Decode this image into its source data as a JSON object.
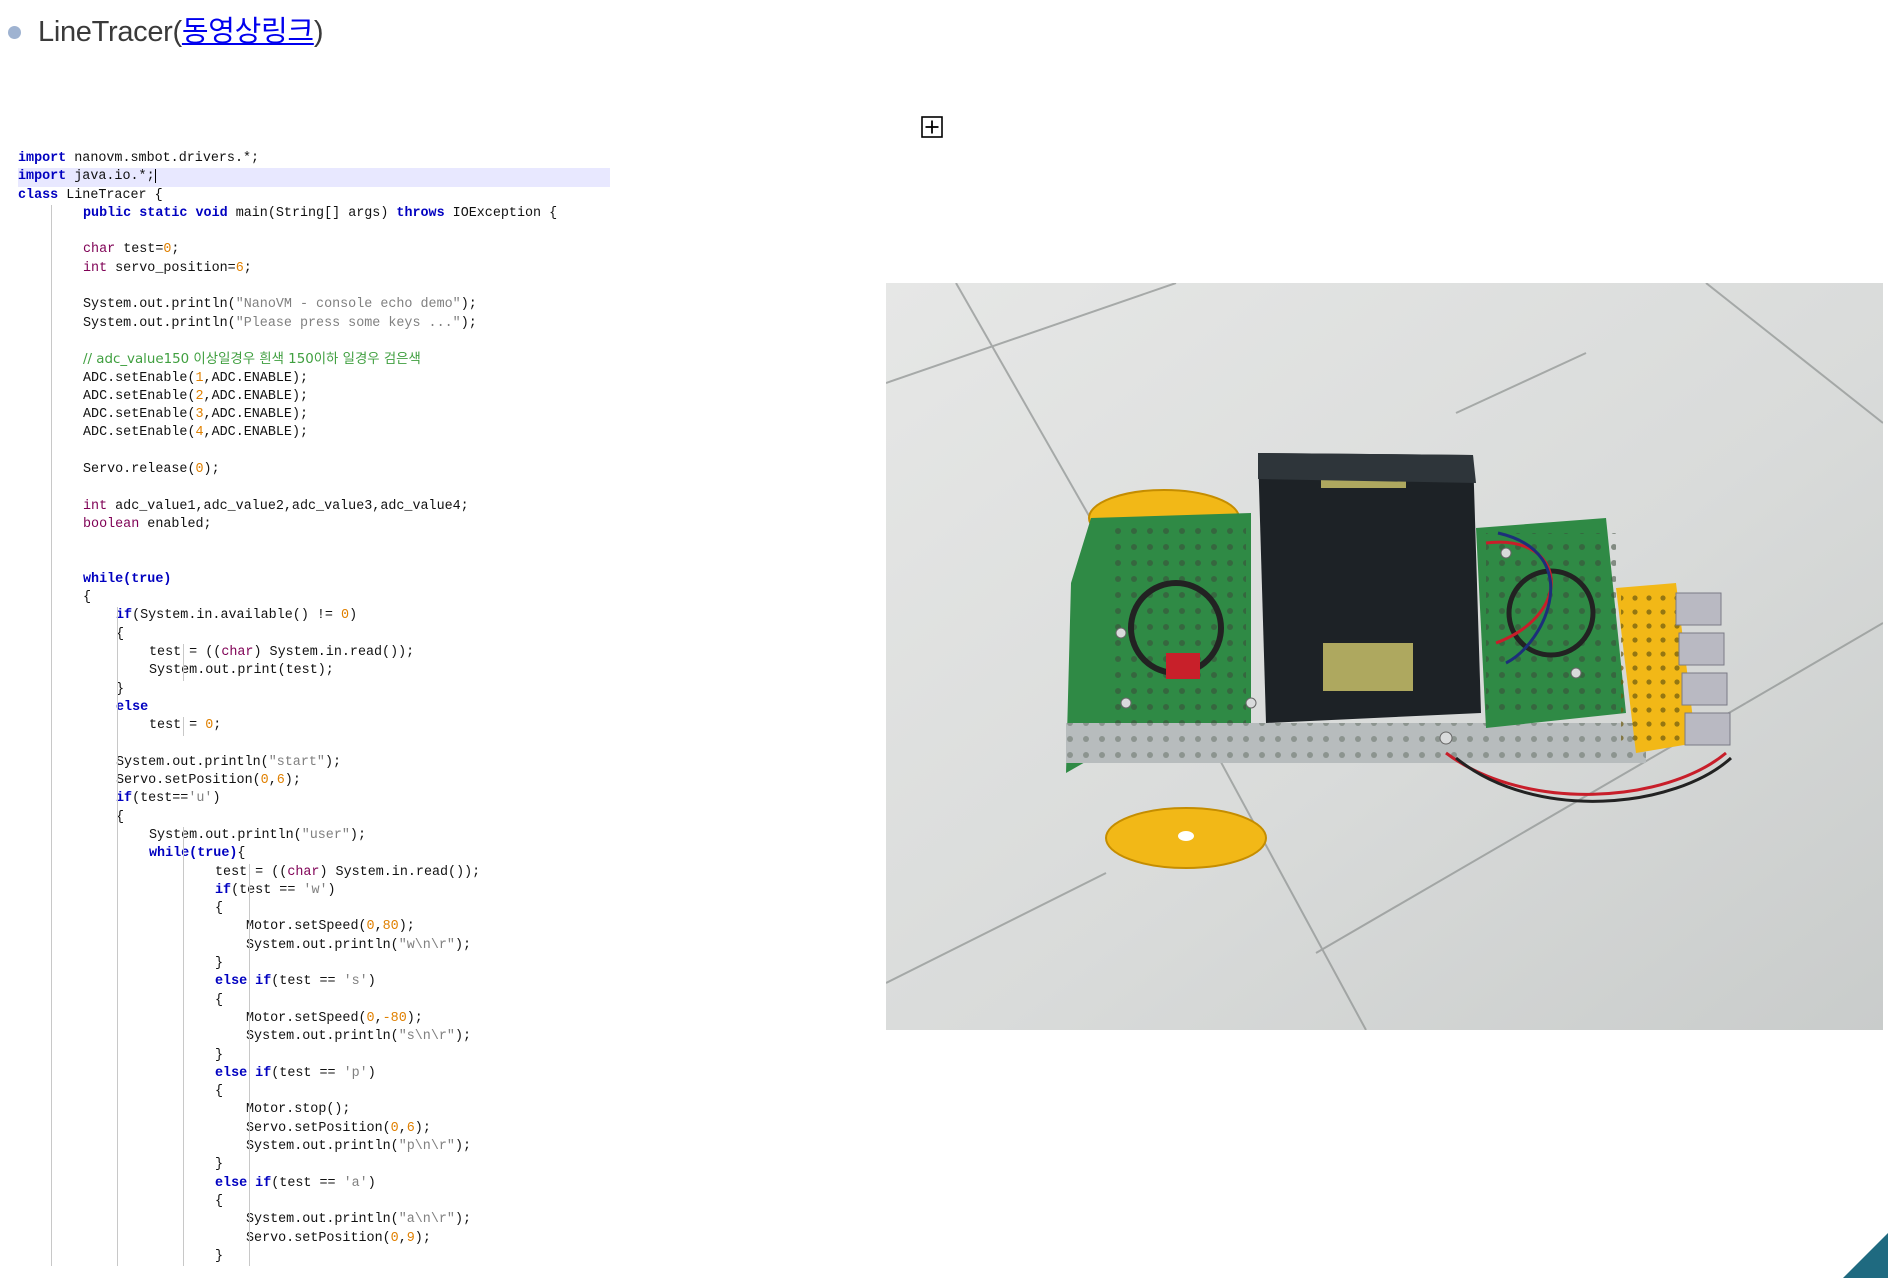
{
  "page": {
    "title_prefix": "LineTracer(",
    "title_link": "동영상링크",
    "title_suffix": ")"
  },
  "colors": {
    "keyword": "#0000c0",
    "type": "#7f0055",
    "number": "#e08000",
    "string": "#808080",
    "comment": "#3f9f3f",
    "link": "#0000ee"
  },
  "icons": {
    "expand": "expand-box-icon",
    "bullet": "bullet-dot-icon"
  },
  "code": {
    "lines": [
      {
        "indent": 0,
        "tokens": [
          {
            "t": "import",
            "c": "kw"
          },
          {
            "t": " nanovm.smbot.drivers.*;",
            "c": ""
          }
        ]
      },
      {
        "indent": 0,
        "hl": true,
        "caret": true,
        "tokens": [
          {
            "t": "import",
            "c": "kw"
          },
          {
            "t": " java.io.*;",
            "c": ""
          }
        ]
      },
      {
        "indent": 0,
        "tokens": [
          {
            "t": "class",
            "c": "kw"
          },
          {
            "t": " LineTracer {",
            "c": ""
          }
        ]
      },
      {
        "indent": 1,
        "tokens": [
          {
            "t": "public static void",
            "c": "kw"
          },
          {
            "t": " main(String[] args) ",
            "c": ""
          },
          {
            "t": "throws",
            "c": "kw"
          },
          {
            "t": " IOException {",
            "c": ""
          }
        ]
      },
      {
        "indent": 1,
        "tokens": []
      },
      {
        "indent": 1,
        "tokens": [
          {
            "t": "char",
            "c": "ty"
          },
          {
            "t": " test=",
            "c": ""
          },
          {
            "t": "0",
            "c": "num"
          },
          {
            "t": ";",
            "c": ""
          }
        ]
      },
      {
        "indent": 1,
        "tokens": [
          {
            "t": "int",
            "c": "ty"
          },
          {
            "t": " servo_position=",
            "c": ""
          },
          {
            "t": "6",
            "c": "num"
          },
          {
            "t": ";",
            "c": ""
          }
        ]
      },
      {
        "indent": 1,
        "tokens": []
      },
      {
        "indent": 1,
        "tokens": [
          {
            "t": "System.out.println(",
            "c": ""
          },
          {
            "t": "\"NanoVM - console echo demo\"",
            "c": "str"
          },
          {
            "t": ");",
            "c": ""
          }
        ]
      },
      {
        "indent": 1,
        "tokens": [
          {
            "t": "System.out.println(",
            "c": ""
          },
          {
            "t": "\"Please press some keys ...\"",
            "c": "str"
          },
          {
            "t": ");",
            "c": ""
          }
        ]
      },
      {
        "indent": 1,
        "tokens": []
      },
      {
        "indent": 1,
        "tokens": [
          {
            "t": "// adc_value150 이상일경우 흰색 150이하 일경우 검은색",
            "c": "cm"
          }
        ]
      },
      {
        "indent": 1,
        "tokens": [
          {
            "t": "ADC.setEnable(",
            "c": ""
          },
          {
            "t": "1",
            "c": "num"
          },
          {
            "t": ",ADC.ENABLE);",
            "c": ""
          }
        ]
      },
      {
        "indent": 1,
        "tokens": [
          {
            "t": "ADC.setEnable(",
            "c": ""
          },
          {
            "t": "2",
            "c": "num"
          },
          {
            "t": ",ADC.ENABLE);",
            "c": ""
          }
        ]
      },
      {
        "indent": 1,
        "tokens": [
          {
            "t": "ADC.setEnable(",
            "c": ""
          },
          {
            "t": "3",
            "c": "num"
          },
          {
            "t": ",ADC.ENABLE);",
            "c": ""
          }
        ]
      },
      {
        "indent": 1,
        "tokens": [
          {
            "t": "ADC.setEnable(",
            "c": ""
          },
          {
            "t": "4",
            "c": "num"
          },
          {
            "t": ",ADC.ENABLE);",
            "c": ""
          }
        ]
      },
      {
        "indent": 1,
        "tokens": []
      },
      {
        "indent": 1,
        "tokens": [
          {
            "t": "Servo.release(",
            "c": ""
          },
          {
            "t": "0",
            "c": "num"
          },
          {
            "t": ");",
            "c": ""
          }
        ]
      },
      {
        "indent": 1,
        "tokens": []
      },
      {
        "indent": 1,
        "tokens": [
          {
            "t": "int",
            "c": "ty"
          },
          {
            "t": " adc_value1,adc_value2,adc_value3,adc_value4;",
            "c": ""
          }
        ]
      },
      {
        "indent": 1,
        "tokens": [
          {
            "t": "boolean",
            "c": "ty"
          },
          {
            "t": " enabled;",
            "c": ""
          }
        ]
      },
      {
        "indent": 1,
        "tokens": []
      },
      {
        "indent": 1,
        "tokens": []
      },
      {
        "indent": 1,
        "tokens": [
          {
            "t": "while(true)",
            "c": "kw"
          }
        ]
      },
      {
        "indent": 1,
        "tokens": [
          {
            "t": "{",
            "c": ""
          }
        ]
      },
      {
        "indent": 2,
        "tokens": [
          {
            "t": "if",
            "c": "kw"
          },
          {
            "t": "(System.in.available() != ",
            "c": ""
          },
          {
            "t": "0",
            "c": "num"
          },
          {
            "t": ")",
            "c": ""
          }
        ]
      },
      {
        "indent": 2,
        "tokens": [
          {
            "t": "{",
            "c": ""
          }
        ]
      },
      {
        "indent": 3,
        "tokens": [
          {
            "t": "test = ((",
            "c": ""
          },
          {
            "t": "char",
            "c": "ty"
          },
          {
            "t": ") System.in.read());",
            "c": ""
          }
        ]
      },
      {
        "indent": 3,
        "tokens": [
          {
            "t": "System.out.print(test);",
            "c": ""
          }
        ]
      },
      {
        "indent": 2,
        "tokens": [
          {
            "t": "}",
            "c": ""
          }
        ]
      },
      {
        "indent": 2,
        "tokens": [
          {
            "t": "else",
            "c": "kw"
          }
        ]
      },
      {
        "indent": 3,
        "tokens": [
          {
            "t": "test = ",
            "c": ""
          },
          {
            "t": "0",
            "c": "num"
          },
          {
            "t": ";",
            "c": ""
          }
        ]
      },
      {
        "indent": 2,
        "tokens": []
      },
      {
        "indent": 2,
        "tokens": [
          {
            "t": "System.out.println(",
            "c": ""
          },
          {
            "t": "\"start\"",
            "c": "str"
          },
          {
            "t": ");",
            "c": ""
          }
        ]
      },
      {
        "indent": 2,
        "tokens": [
          {
            "t": "Servo.setPosition(",
            "c": ""
          },
          {
            "t": "0",
            "c": "num"
          },
          {
            "t": ",",
            "c": ""
          },
          {
            "t": "6",
            "c": "num"
          },
          {
            "t": ");",
            "c": ""
          }
        ]
      },
      {
        "indent": 2,
        "tokens": [
          {
            "t": "if",
            "c": "kw"
          },
          {
            "t": "(test==",
            "c": ""
          },
          {
            "t": "'u'",
            "c": "str"
          },
          {
            "t": ")",
            "c": ""
          }
        ]
      },
      {
        "indent": 2,
        "tokens": [
          {
            "t": "{",
            "c": ""
          }
        ]
      },
      {
        "indent": 3,
        "tokens": [
          {
            "t": "System.out.println(",
            "c": ""
          },
          {
            "t": "\"user\"",
            "c": "str"
          },
          {
            "t": ");",
            "c": ""
          }
        ]
      },
      {
        "indent": 3,
        "tokens": [
          {
            "t": "while(true)",
            "c": "kw"
          },
          {
            "t": "{",
            "c": ""
          }
        ]
      },
      {
        "indent": 5,
        "tokens": [
          {
            "t": "test = ((",
            "c": ""
          },
          {
            "t": "char",
            "c": "ty"
          },
          {
            "t": ") System.in.read());",
            "c": ""
          }
        ]
      },
      {
        "indent": 5,
        "tokens": [
          {
            "t": "if",
            "c": "kw"
          },
          {
            "t": "(test == ",
            "c": ""
          },
          {
            "t": "'w'",
            "c": "str"
          },
          {
            "t": ")",
            "c": ""
          }
        ]
      },
      {
        "indent": 5,
        "tokens": [
          {
            "t": "{",
            "c": ""
          }
        ]
      },
      {
        "indent": 6,
        "tokens": [
          {
            "t": "Motor.setSpeed(",
            "c": ""
          },
          {
            "t": "0",
            "c": "num"
          },
          {
            "t": ",",
            "c": ""
          },
          {
            "t": "80",
            "c": "num"
          },
          {
            "t": ");",
            "c": ""
          }
        ]
      },
      {
        "indent": 6,
        "tokens": [
          {
            "t": "System.out.println(",
            "c": ""
          },
          {
            "t": "\"w\\n\\r\"",
            "c": "str"
          },
          {
            "t": ");",
            "c": ""
          }
        ]
      },
      {
        "indent": 5,
        "tokens": [
          {
            "t": "}",
            "c": ""
          }
        ]
      },
      {
        "indent": 5,
        "tokens": [
          {
            "t": "else if",
            "c": "kw"
          },
          {
            "t": "(test == ",
            "c": ""
          },
          {
            "t": "'s'",
            "c": "str"
          },
          {
            "t": ")",
            "c": ""
          }
        ]
      },
      {
        "indent": 5,
        "tokens": [
          {
            "t": "{",
            "c": ""
          }
        ]
      },
      {
        "indent": 6,
        "tokens": [
          {
            "t": "Motor.setSpeed(",
            "c": ""
          },
          {
            "t": "0",
            "c": "num"
          },
          {
            "t": ",",
            "c": ""
          },
          {
            "t": "-80",
            "c": "num"
          },
          {
            "t": ");",
            "c": ""
          }
        ]
      },
      {
        "indent": 6,
        "tokens": [
          {
            "t": "System.out.println(",
            "c": ""
          },
          {
            "t": "\"s\\n\\r\"",
            "c": "str"
          },
          {
            "t": ");",
            "c": ""
          }
        ]
      },
      {
        "indent": 5,
        "tokens": [
          {
            "t": "}",
            "c": ""
          }
        ]
      },
      {
        "indent": 5,
        "tokens": [
          {
            "t": "else if",
            "c": "kw"
          },
          {
            "t": "(test == ",
            "c": ""
          },
          {
            "t": "'p'",
            "c": "str"
          },
          {
            "t": ")",
            "c": ""
          }
        ]
      },
      {
        "indent": 5,
        "tokens": [
          {
            "t": "{",
            "c": ""
          }
        ]
      },
      {
        "indent": 6,
        "tokens": [
          {
            "t": "Motor.stop();",
            "c": ""
          }
        ]
      },
      {
        "indent": 6,
        "tokens": [
          {
            "t": "Servo.setPosition(",
            "c": ""
          },
          {
            "t": "0",
            "c": "num"
          },
          {
            "t": ",",
            "c": ""
          },
          {
            "t": "6",
            "c": "num"
          },
          {
            "t": ");",
            "c": ""
          }
        ]
      },
      {
        "indent": 6,
        "tokens": [
          {
            "t": "System.out.println(",
            "c": ""
          },
          {
            "t": "\"p\\n\\r\"",
            "c": "str"
          },
          {
            "t": ");",
            "c": ""
          }
        ]
      },
      {
        "indent": 5,
        "tokens": [
          {
            "t": "}",
            "c": ""
          }
        ]
      },
      {
        "indent": 5,
        "tokens": [
          {
            "t": "else if",
            "c": "kw"
          },
          {
            "t": "(test == ",
            "c": ""
          },
          {
            "t": "'a'",
            "c": "str"
          },
          {
            "t": ")",
            "c": ""
          }
        ]
      },
      {
        "indent": 5,
        "tokens": [
          {
            "t": "{",
            "c": ""
          }
        ]
      },
      {
        "indent": 6,
        "tokens": [
          {
            "t": "System.out.println(",
            "c": ""
          },
          {
            "t": "\"a\\n\\r\"",
            "c": "str"
          },
          {
            "t": ");",
            "c": ""
          }
        ]
      },
      {
        "indent": 6,
        "tokens": [
          {
            "t": "Servo.setPosition(",
            "c": ""
          },
          {
            "t": "0",
            "c": "num"
          },
          {
            "t": ",",
            "c": ""
          },
          {
            "t": "9",
            "c": "num"
          },
          {
            "t": ");",
            "c": ""
          }
        ]
      },
      {
        "indent": 5,
        "tokens": [
          {
            "t": "}",
            "c": ""
          }
        ]
      }
    ]
  }
}
